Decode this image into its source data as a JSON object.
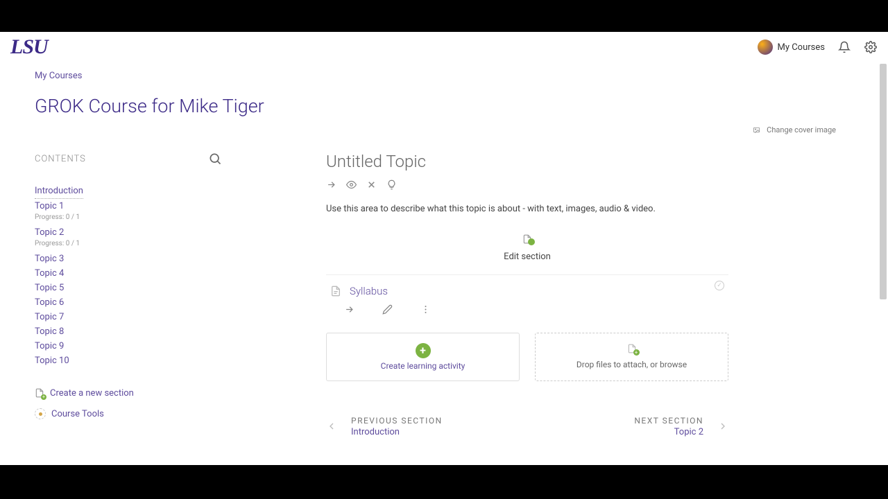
{
  "header": {
    "logo_text": "LSU",
    "my_courses": "My Courses"
  },
  "breadcrumb": {
    "my_courses": "My Courses"
  },
  "course": {
    "title": "GROK Course for Mike Tiger",
    "change_cover": "Change cover image"
  },
  "sidebar": {
    "contents_label": "CONTENTS",
    "items": [
      {
        "label": "Introduction",
        "progress": ""
      },
      {
        "label": "Topic 1",
        "progress": "Progress: 0 / 1"
      },
      {
        "label": "Topic 2",
        "progress": "Progress: 0 / 1"
      },
      {
        "label": "Topic 3",
        "progress": ""
      },
      {
        "label": "Topic 4",
        "progress": ""
      },
      {
        "label": "Topic 5",
        "progress": ""
      },
      {
        "label": "Topic 6",
        "progress": ""
      },
      {
        "label": "Topic 7",
        "progress": ""
      },
      {
        "label": "Topic 8",
        "progress": ""
      },
      {
        "label": "Topic 9",
        "progress": ""
      },
      {
        "label": "Topic 10",
        "progress": ""
      }
    ],
    "create_section": "Create a new section",
    "course_tools": "Course Tools"
  },
  "main": {
    "topic_title": "Untitled Topic",
    "topic_desc": "Use this area to describe what this topic is about - with text, images, audio & video.",
    "edit_section": "Edit section",
    "activity_name": "Syllabus",
    "create_activity": "Create learning activity",
    "drop_files": "Drop files to attach, or browse",
    "prev_label": "PREVIOUS SECTION",
    "prev_name": "Introduction",
    "next_label": "NEXT SECTION",
    "next_name": "Topic 2"
  }
}
